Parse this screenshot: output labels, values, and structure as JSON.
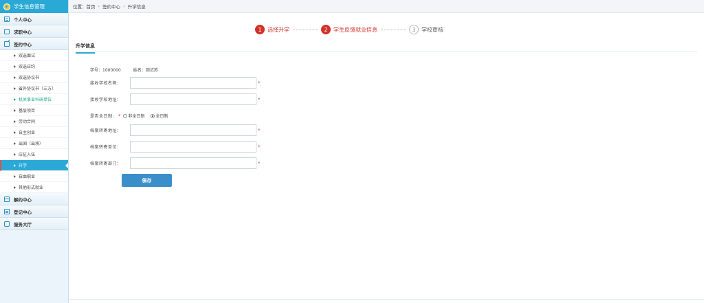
{
  "sidebar": {
    "title": "学生信息管理",
    "sections": [
      {
        "label": "个人中心"
      },
      {
        "label": "求职中心"
      },
      {
        "label": "签约中心"
      }
    ],
    "sign_items": [
      "双选面试",
      "双选应约",
      "双选协议书",
      "省外协议书（三方）",
      "机关事业科研单位",
      "基层项目",
      "劳动合同",
      "自主创业",
      "出国（出境）",
      "应征入伍",
      "升学",
      "自由职业",
      "其他形式就业"
    ],
    "sections_bottom": [
      {
        "label": "解约中心"
      },
      {
        "label": "登记中心"
      },
      {
        "label": "服务大厅"
      }
    ]
  },
  "breadcrumb": {
    "prefix": "位置：",
    "items": [
      "首页",
      "签约中心",
      "升学信息"
    ],
    "sep": "›"
  },
  "steps": [
    {
      "num": "1",
      "label": "选择升学"
    },
    {
      "num": "2",
      "label": "学生反馈就业信息"
    },
    {
      "num": "3",
      "label": "学校审核"
    }
  ],
  "tab": {
    "label": "升学信息"
  },
  "student": {
    "id_label": "学号：1000000",
    "name_label": "姓名：测试苏"
  },
  "form": {
    "school_name_label": "接收学校名称：",
    "school_addr_label": "接收学校地址：",
    "fulltime_label": "是否全日制：",
    "opt_parttime": "非全日制",
    "opt_fulltime": "全日制",
    "archive_addr_label": "档案转寄地址：",
    "archive_unit_label": "档案转寄单位：",
    "archive_dept_label": "档案转寄部门：",
    "required": "*",
    "save_label": "保存"
  },
  "colors": {
    "accent": "#2aa8d6",
    "step_active": "#d0322a",
    "save_button": "#3a8fca"
  }
}
